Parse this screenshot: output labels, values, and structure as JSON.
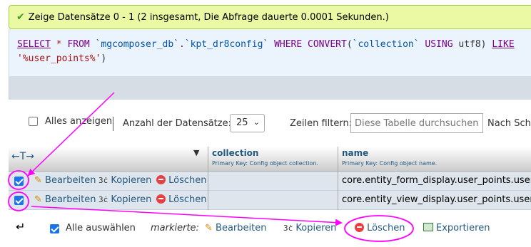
{
  "message": {
    "text": "Zeige Datensätze 0 - 1 (2 insgesamt, Die Abfrage dauerte 0.0001 Sekunden.)"
  },
  "sql": {
    "select": "SELECT",
    "star": "*",
    "from": "FROM",
    "db": "`mgcomposer_db`",
    "dot": ".",
    "table": "`kpt_dr8config`",
    "where": "WHERE",
    "convert": "CONVERT",
    "paren_open": "(",
    "column": "`collection`",
    "using": "USING",
    "charset": "utf8)",
    "like": "LIKE",
    "pattern": "'%user_points%'",
    "paren_close": ")"
  },
  "nav": {
    "show_all_label": "Alles anzeigen",
    "row_count_label": "Anzahl der Datensätze:",
    "row_count_value": "25",
    "filter_label": "Zeilen filtern:",
    "filter_placeholder": "Diese Tabelle durchsuchen",
    "sort_label": "Nach Schl"
  },
  "table": {
    "sort_arrows": "←T→",
    "sort_indicator": "▼",
    "columns": [
      {
        "name": "collection",
        "comment": "Primary Key: Config object collection."
      },
      {
        "name": "name",
        "comment": "Primary Key: Config object name."
      }
    ],
    "row_actions": {
      "edit": "Bearbeiten",
      "copy": "Kopieren",
      "delete": "Löschen"
    },
    "rows": [
      {
        "collection": "",
        "name": "core.entity_form_display.user_points.user_poi"
      },
      {
        "collection": "",
        "name": "core.entity_view_display.user_points.user_poi"
      }
    ]
  },
  "bulk": {
    "select_all_label": "Alle auswählen",
    "with_selected_label": "markierte:",
    "edit": "Bearbeiten",
    "copy": "Kopieren",
    "delete": "Löschen",
    "export": "Exportieren"
  },
  "colors": {
    "success_bg": "#ebf8a4",
    "link": "#235a81",
    "annotation": "#ff00ff",
    "checkbox": "#1a73e8"
  }
}
